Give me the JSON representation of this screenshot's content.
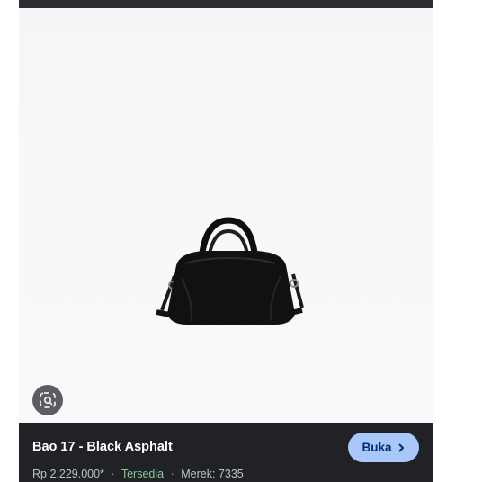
{
  "product": {
    "title": "Bao 17 - Black Asphalt",
    "price": "Rp 2.229.000*",
    "availability": "Tersedia",
    "brand": "Merek: 7335",
    "separator": "·"
  },
  "actions": {
    "open_label": "Buka"
  },
  "icons": {
    "lens": "lens-search-icon",
    "chevron": "chevron-right-icon"
  },
  "colors": {
    "info_bar": "#202226",
    "open_button": "#a8c7fa",
    "availability": "#81c995"
  }
}
